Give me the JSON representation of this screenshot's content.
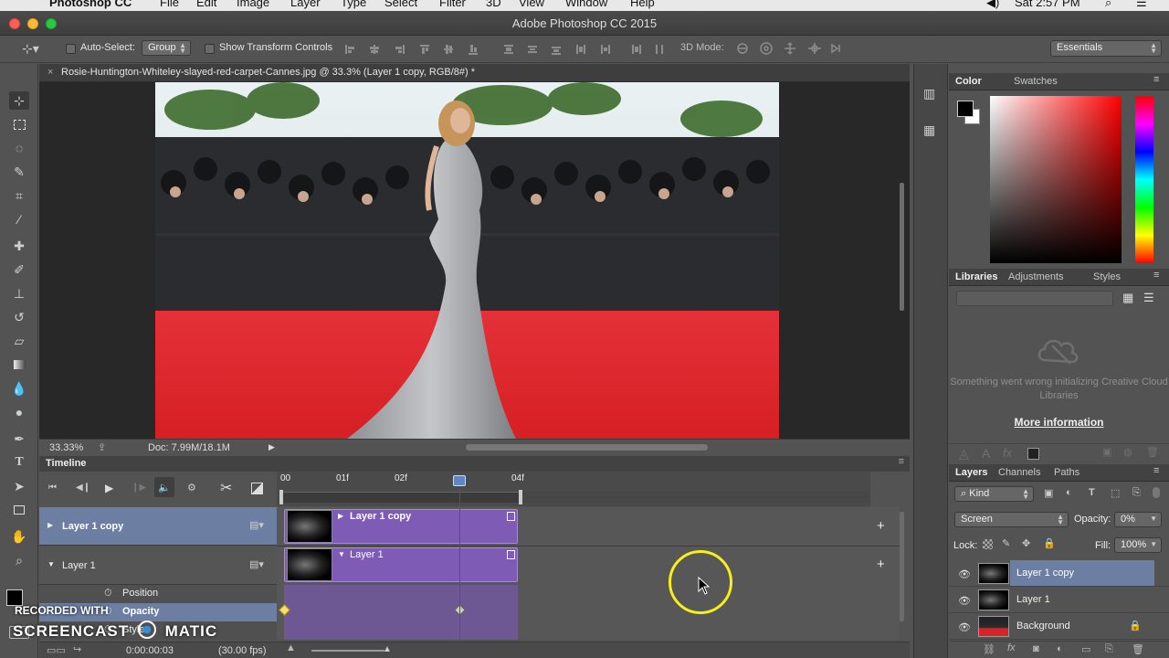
{
  "menubar": {
    "app_name": "Photoshop CC",
    "items": [
      "File",
      "Edit",
      "Image",
      "Layer",
      "Type",
      "Select",
      "Filter",
      "3D",
      "View",
      "Window",
      "Help"
    ],
    "clock": "Sat 2:57 PM"
  },
  "window": {
    "title": "Adobe Photoshop CC 2015"
  },
  "options": {
    "auto_select_label": "Auto-Select:",
    "auto_select_value": "Group",
    "show_transform_label": "Show Transform Controls",
    "mode_3d_label": "3D Mode:",
    "workspace": "Essentials"
  },
  "document": {
    "tab_title": "Rosie-Huntington-Whiteley-slayed-red-carpet-Cannes.jpg @ 33.3% (Layer 1 copy, RGB/8#) *",
    "zoom": "33.33%",
    "doc_info": "Doc: 7.99M/18.1M"
  },
  "timeline": {
    "title": "Timeline",
    "ruler_labels": [
      "00",
      "01f",
      "02f",
      "04f"
    ],
    "layers": [
      {
        "name": "Layer 1 copy",
        "clip_label": "Layer 1 copy"
      },
      {
        "name": "Layer 1",
        "clip_label": "Layer 1"
      }
    ],
    "props": [
      "Position",
      "Opacity",
      "Style"
    ],
    "timecode": "0:00:00:03",
    "fps": "(30.00 fps)"
  },
  "color_panel": {
    "tabs": [
      "Color",
      "Swatches"
    ],
    "foreground": "#000000",
    "background": "#ffffff"
  },
  "libraries_panel": {
    "tabs": [
      "Libraries",
      "Adjustments",
      "Styles"
    ],
    "message": "Something went wrong initializing Creative Cloud Libraries",
    "link": "More information"
  },
  "layers_panel": {
    "tabs": [
      "Layers",
      "Channels",
      "Paths"
    ],
    "kind": "Kind",
    "blend_mode": "Screen",
    "opacity_label": "Opacity:",
    "opacity_value": "0%",
    "lock_label": "Lock:",
    "fill_label": "Fill:",
    "fill_value": "100%",
    "layers": [
      "Layer 1 copy",
      "Layer 1",
      "Background"
    ],
    "selected": "Layer 1 copy"
  },
  "watermark": {
    "line1": "RECORDED WITH",
    "line2a": "SCREENCAST",
    "line2b": "MATIC"
  },
  "colors": {
    "accent_selected": "#6c7fa3",
    "clip_purple": "#7e5bb5",
    "red_carpet": "#e0262a",
    "playhead": "#c0282f"
  }
}
